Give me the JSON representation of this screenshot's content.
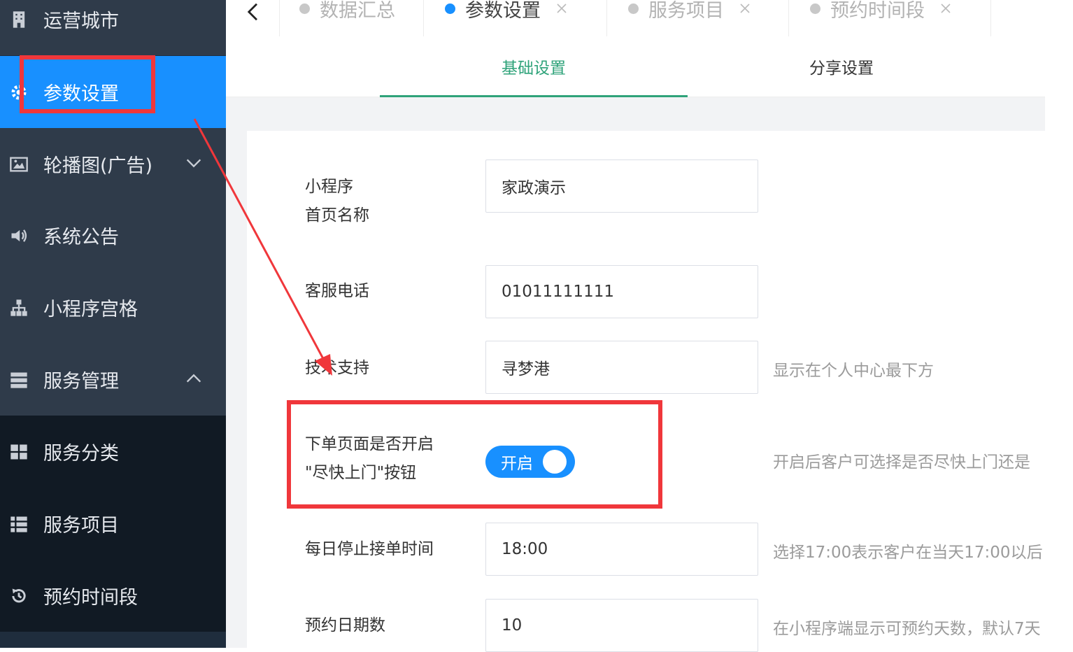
{
  "sidebar": {
    "items": [
      {
        "label": "运营城市",
        "icon": "building-icon"
      },
      {
        "label": "参数设置",
        "icon": "gear-icon"
      },
      {
        "label": "轮播图(广告)",
        "icon": "image-icon"
      },
      {
        "label": "系统公告",
        "icon": "speaker-icon"
      },
      {
        "label": "小程序宫格",
        "icon": "sitemap-icon"
      },
      {
        "label": "服务管理",
        "icon": "server-icon"
      },
      {
        "label": "服务分类",
        "icon": "grid-icon"
      },
      {
        "label": "服务项目",
        "icon": "list-icon"
      },
      {
        "label": "预约时间段",
        "icon": "history-icon"
      }
    ]
  },
  "tabs": [
    {
      "label": "数据汇总"
    },
    {
      "label": "参数设置"
    },
    {
      "label": "服务项目"
    },
    {
      "label": "预约时间段"
    }
  ],
  "subtabs": {
    "basic": "基础设置",
    "share": "分享设置"
  },
  "form": {
    "name_label_1": "小程序",
    "name_label_2": "首页名称",
    "name_value": "家政演示",
    "phone_label": "客服电话",
    "phone_value": "01011111111",
    "support_label": "技术支持",
    "support_value": "寻梦港",
    "support_hint": "显示在个人中心最下方",
    "asap_label_1": "下单页面是否开启",
    "asap_label_2": "\"尽快上门\"按钮",
    "asap_switch": "开启",
    "asap_hint": "开启后客户可选择是否尽快上门还是",
    "stop_label": "每日停止接单时间",
    "stop_value": "18:00",
    "stop_hint": "选择17:00表示客户在当天17:00以后",
    "days_label": "预约日期数",
    "days_value": "10",
    "days_hint": "在小程序端显示可预约天数，默认7天"
  },
  "colors": {
    "accent": "#1890ff",
    "subtab_active": "#2fa37a",
    "annotation": "#f0373b",
    "sidebar": "#1f2d3d"
  }
}
